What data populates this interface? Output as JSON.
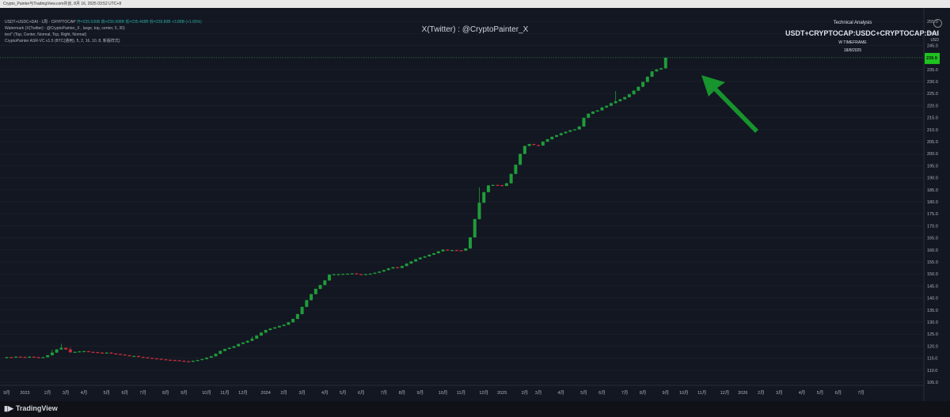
{
  "topbar": {
    "text": "Crypto_Painter与TradingView.com共创, 8月 16, 2025 03:52 UTC+8"
  },
  "legend": {
    "line1_pre": "USDT+USDC+DAI · 1周 · CRYPTOCAP",
    "line1_vals": "开=235.536B 高=239.998B 低=235.468B 收=239.89B +3.88B (+1.65%)",
    "line2": "Watermark (X(Twitter) : @CryptoPainter_X , large, top, center, 5, 30)",
    "line3": "text\" (Top, Center, Normal, Top, Right, Normal)",
    "line4": "CryptoPainter ASR-VC v1.5 (BTC(通用), 5, 2, 16, 10, 8, 新版样式)"
  },
  "watermark": "X(Twitter) : @CryptoPainter_X",
  "analysis": {
    "title": "Technical Analysis",
    "symbol": "USDT+CRYPTOCAP:USDC+CRYPTOCAP:DAI",
    "timeframe": "W TIMEFRAME",
    "date": "18/8/2025"
  },
  "currency": "USD",
  "logo": "TradingView",
  "colors": {
    "up": "#1f9c3a",
    "down": "#c62d3a",
    "arrow": "#18a02f",
    "last_price_bg": "#1ec41e"
  },
  "last_price_label": "239.9",
  "chart_data": {
    "type": "candlestick",
    "unit": "B USD",
    "y_ticks": [
      105.0,
      110.0,
      115.0,
      120.0,
      125.0,
      130.0,
      135.0,
      140.0,
      145.0,
      150.0,
      155.0,
      160.0,
      165.0,
      170.0,
      175.0,
      180.0,
      185.0,
      190.0,
      195.0,
      200.0,
      205.0,
      210.0,
      215.0,
      220.0,
      225.0,
      230.0,
      235.0,
      240.0,
      245.0,
      250.0,
      255.0
    ],
    "y_range": [
      101,
      257
    ],
    "x_labels": [
      "9月",
      "2023",
      "2月",
      "3月",
      "4月",
      "5月",
      "6月",
      "7月",
      "8月",
      "9月",
      "10月",
      "11月",
      "12月",
      "2024",
      "2月",
      "3月",
      "4月",
      "5月",
      "6月",
      "7月",
      "8月",
      "9月",
      "10月",
      "11月",
      "12月",
      "2025",
      "2月",
      "3月",
      "4月",
      "5月",
      "6月",
      "7月",
      "8月",
      "9月",
      "10月",
      "11月",
      "12月",
      "2026",
      "2月",
      "3月",
      "4月",
      "5月",
      "6月",
      "7月"
    ],
    "x_label_positions_week": [
      0,
      4,
      9,
      13,
      17,
      22,
      26,
      30,
      35,
      39,
      44,
      48,
      52,
      57,
      61,
      65,
      70,
      74,
      78,
      83,
      87,
      91,
      96,
      100,
      105,
      109,
      114,
      117,
      122,
      127,
      131,
      136,
      140,
      145,
      149,
      153,
      158,
      162,
      166,
      170,
      175,
      179,
      183,
      188
    ],
    "closes": [
      115.4,
      115.3,
      115.6,
      115.5,
      115.2,
      115.6,
      115.4,
      115.1,
      115.4,
      116.2,
      117.3,
      118.6,
      119.3,
      118.6,
      117.4,
      117.6,
      117.8,
      117.9,
      117.6,
      117.5,
      117.3,
      117.0,
      117.3,
      116.9,
      116.7,
      116.5,
      116.2,
      115.9,
      115.9,
      115.5,
      115.3,
      115.1,
      114.9,
      114.7,
      114.5,
      114.3,
      114.2,
      114.1,
      113.9,
      113.7,
      113.5,
      113.9,
      114.2,
      114.6,
      115.2,
      115.8,
      116.8,
      118.0,
      118.8,
      119.3,
      119.9,
      120.9,
      121.5,
      122.2,
      123.1,
      124.4,
      125.6,
      126.7,
      127.3,
      127.8,
      128.4,
      128.9,
      129.9,
      131.3,
      133.3,
      136.3,
      139.1,
      141.6,
      143.8,
      145.4,
      147.3,
      149.7,
      149.9,
      149.9,
      150.0,
      150.1,
      150.2,
      149.9,
      149.8,
      149.9,
      150.1,
      150.5,
      151.0,
      151.6,
      152.3,
      152.8,
      152.5,
      153.3,
      154.3,
      155.2,
      156.1,
      156.8,
      157.3,
      158.0,
      158.6,
      159.4,
      160.1,
      159.8,
      159.9,
      159.8,
      159.7,
      160.6,
      165.2,
      172.8,
      179.6,
      184.0,
      186.8,
      187.0,
      186.9,
      186.6,
      187.7,
      191.6,
      195.4,
      199.9,
      203.2,
      204.0,
      203.6,
      203.4,
      205.0,
      206.0,
      207.0,
      207.7,
      208.5,
      209.1,
      209.7,
      210.1,
      211.3,
      214.9,
      216.6,
      217.5,
      218.0,
      219.2,
      219.9,
      221.0,
      221.8,
      222.6,
      223.5,
      224.7,
      226.2,
      227.8,
      229.8,
      232.0,
      234.2,
      235.0,
      235.5,
      239.9
    ],
    "highs": {
      "10": 118.5,
      "12": 121.0,
      "14": 119.5,
      "54": 124.0,
      "104": 186.0,
      "134": 226.0
    }
  }
}
